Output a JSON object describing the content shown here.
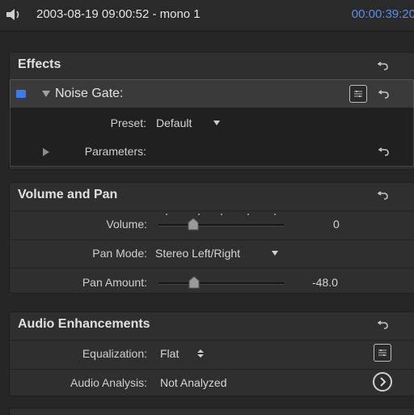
{
  "header": {
    "clip_title": "2003-08-19 09:00:52 - mono 1",
    "timecode": "00:00:39:20",
    "speaker_icon": "speaker-icon"
  },
  "effects": {
    "title": "Effects",
    "effect_name": "Noise Gate:",
    "preset_label": "Preset:",
    "preset_value": "Default",
    "parameters_label": "Parameters:"
  },
  "volume_pan": {
    "title": "Volume and Pan",
    "volume_label": "Volume:",
    "volume_value": "0",
    "pan_mode_label": "Pan Mode:",
    "pan_mode_value": "Stereo Left/Right",
    "pan_amount_label": "Pan Amount:",
    "pan_amount_value": "-48.0"
  },
  "audio_enhancements": {
    "title": "Audio Enhancements",
    "equalization_label": "Equalization:",
    "equalization_value": "Flat",
    "audio_analysis_label": "Audio Analysis:",
    "audio_analysis_value": "Not Analyzed"
  },
  "colors": {
    "accent": "#3f7be6",
    "timecode": "#5a8fe8"
  }
}
